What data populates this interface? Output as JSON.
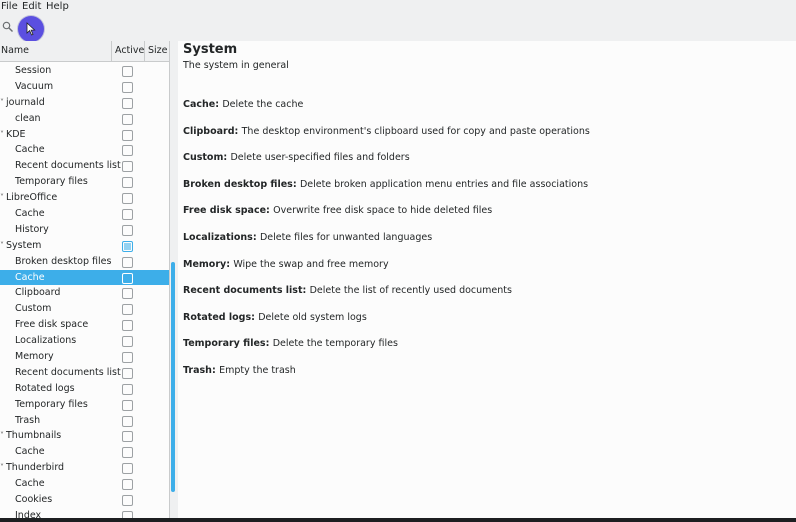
{
  "menu": [
    "File",
    "Edit",
    "Help"
  ],
  "tree": {
    "columns": {
      "name": "Name",
      "active": "Active",
      "size": "Size"
    },
    "rows": [
      {
        "label": "Session",
        "level": 1,
        "state": "off"
      },
      {
        "label": "Vacuum",
        "level": 1,
        "state": "off"
      },
      {
        "label": "journald",
        "level": 0,
        "state": "off"
      },
      {
        "label": "clean",
        "level": 1,
        "state": "off"
      },
      {
        "label": "KDE",
        "level": 0,
        "state": "off"
      },
      {
        "label": "Cache",
        "level": 1,
        "state": "off"
      },
      {
        "label": "Recent documents list",
        "level": 1,
        "state": "off"
      },
      {
        "label": "Temporary files",
        "level": 1,
        "state": "off"
      },
      {
        "label": "LibreOffice",
        "level": 0,
        "state": "off"
      },
      {
        "label": "Cache",
        "level": 1,
        "state": "off"
      },
      {
        "label": "History",
        "level": 1,
        "state": "off"
      },
      {
        "label": "System",
        "level": 0,
        "state": "partial"
      },
      {
        "label": "Broken desktop files",
        "level": 1,
        "state": "off"
      },
      {
        "label": "Cache",
        "level": 1,
        "state": "off",
        "selected": true
      },
      {
        "label": "Clipboard",
        "level": 1,
        "state": "off"
      },
      {
        "label": "Custom",
        "level": 1,
        "state": "off"
      },
      {
        "label": "Free disk space",
        "level": 1,
        "state": "off"
      },
      {
        "label": "Localizations",
        "level": 1,
        "state": "off"
      },
      {
        "label": "Memory",
        "level": 1,
        "state": "off"
      },
      {
        "label": "Recent documents list",
        "level": 1,
        "state": "off"
      },
      {
        "label": "Rotated logs",
        "level": 1,
        "state": "off"
      },
      {
        "label": "Temporary files",
        "level": 1,
        "state": "off"
      },
      {
        "label": "Trash",
        "level": 1,
        "state": "off"
      },
      {
        "label": "Thumbnails",
        "level": 0,
        "state": "off"
      },
      {
        "label": "Cache",
        "level": 1,
        "state": "off"
      },
      {
        "label": "Thunderbird",
        "level": 0,
        "state": "off"
      },
      {
        "label": "Cache",
        "level": 1,
        "state": "off"
      },
      {
        "label": "Cookies",
        "level": 1,
        "state": "off"
      },
      {
        "label": "Index",
        "level": 1,
        "state": "off"
      }
    ]
  },
  "detail": {
    "title": "System",
    "description": "The system in general",
    "options": [
      {
        "name": "Cache",
        "text": "Delete the cache"
      },
      {
        "name": "Clipboard",
        "text": "The desktop environment's clipboard used for copy and paste operations"
      },
      {
        "name": "Custom",
        "text": "Delete user-specified files and folders"
      },
      {
        "name": "Broken desktop files",
        "text": "Delete broken application menu entries and file associations"
      },
      {
        "name": "Free disk space",
        "text": "Overwrite free disk space to hide deleted files"
      },
      {
        "name": "Localizations",
        "text": "Delete files for unwanted languages"
      },
      {
        "name": "Memory",
        "text": "Wipe the swap and free memory"
      },
      {
        "name": "Recent documents list",
        "text": "Delete the list of recently used documents"
      },
      {
        "name": "Rotated logs",
        "text": "Delete old system logs"
      },
      {
        "name": "Temporary files",
        "text": "Delete the temporary files"
      },
      {
        "name": "Trash",
        "text": "Empty the trash"
      }
    ]
  },
  "colors": {
    "accent": "#3daee9",
    "cursor_badge": "#5b4fe0"
  },
  "icons": {
    "search": "search-icon",
    "cursor": "mouse-pointer-icon",
    "expand": "chevron-down-icon"
  }
}
